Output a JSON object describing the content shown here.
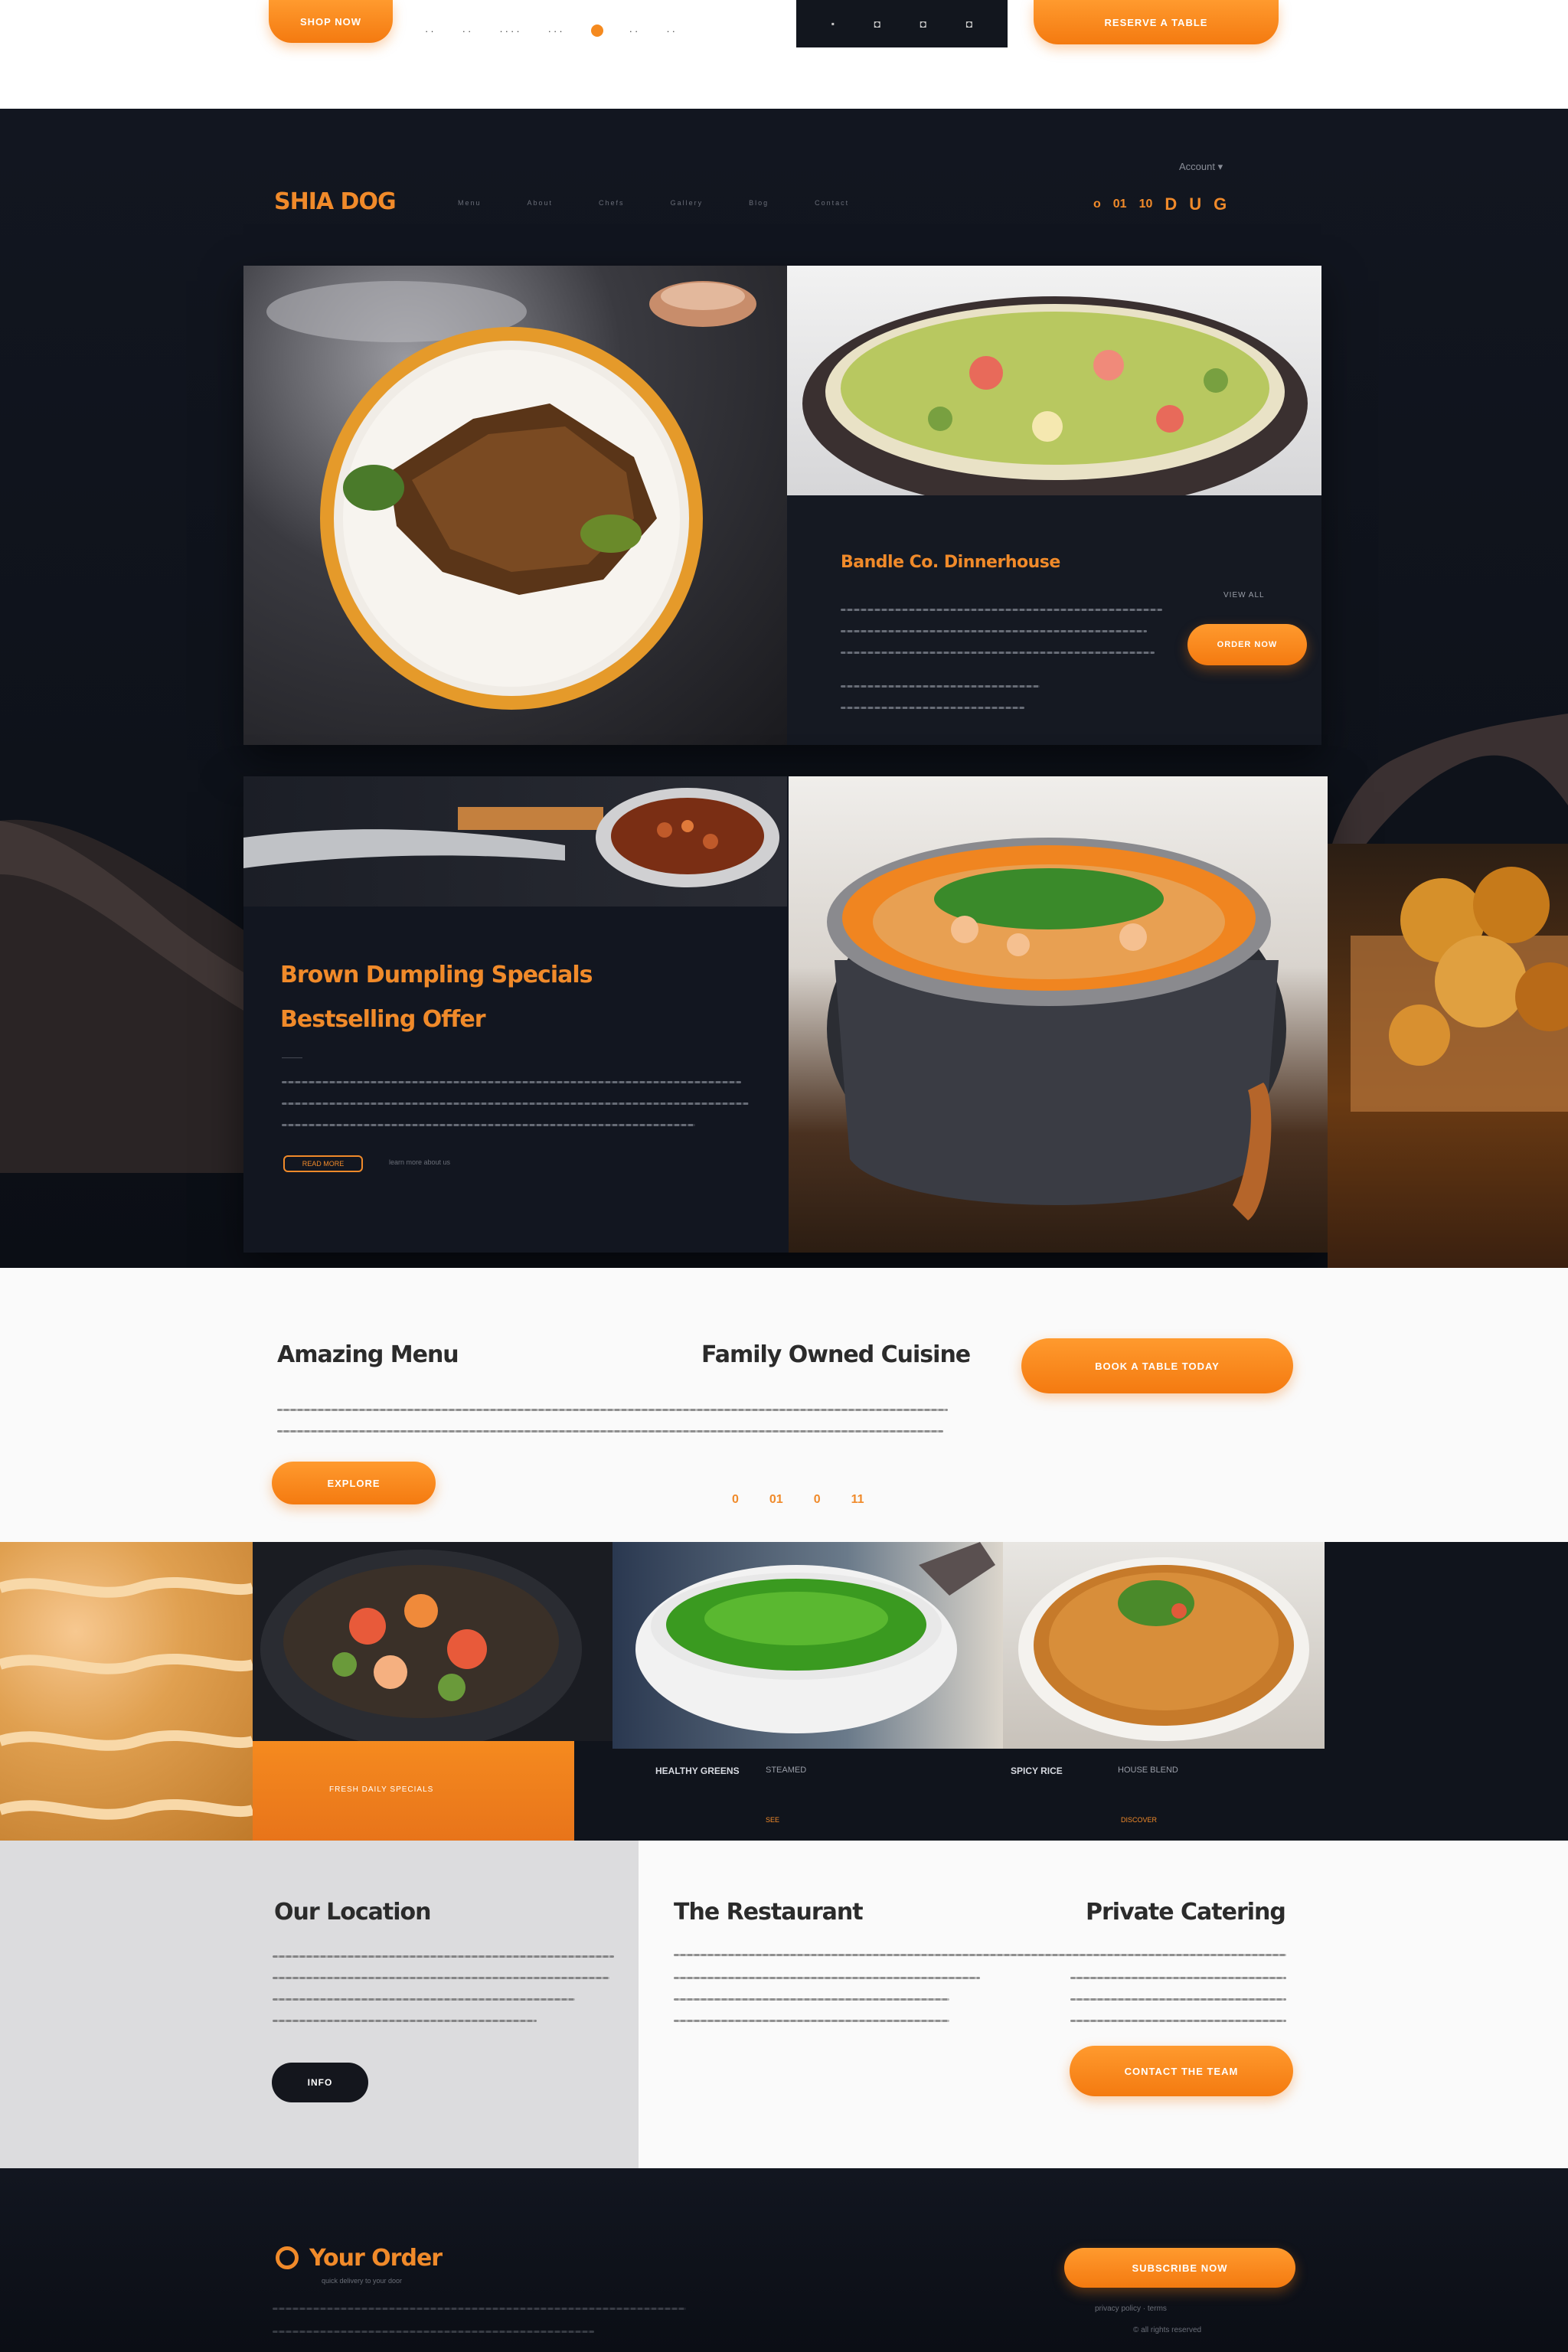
{
  "top": {
    "left_button": "SHOP NOW",
    "nav_dots": [
      "··",
      "··",
      "····",
      "···",
      "···",
      "··",
      "··"
    ],
    "dark_box_items": [
      "▪",
      "◘",
      "◘",
      "◘"
    ],
    "right_button": "RESERVE A TABLE"
  },
  "hero": {
    "logo": "SHIA DOG",
    "nav_items": [
      "Menu",
      "About",
      "Chefs",
      "Gallery",
      "Blog",
      "Contact"
    ],
    "account_label": "Account ▾",
    "right_nav": [
      "o",
      "01",
      "10",
      "D",
      "U",
      "G"
    ],
    "card1": {
      "title": "Bandle Co. Dinnerhouse",
      "tag": "VIEW ALL",
      "button": "ORDER NOW",
      "lines": [
        "",
        "",
        "",
        ""
      ]
    },
    "card2": {
      "title_line1": "Brown Dumpling Specials",
      "title_line2": "Bestselling Offer",
      "meta": "———",
      "link": "READ MORE",
      "link2": "learn more about us"
    }
  },
  "intro": {
    "title_left": "Amazing Menu",
    "title_center": "Family Owned Cuisine",
    "button_right": "BOOK A TABLE TODAY",
    "button_left": "EXPLORE",
    "pagination": [
      "0",
      "01",
      "0",
      "11"
    ]
  },
  "gallery": {
    "caption1": "FRESH DAILY SPECIALS",
    "caption2_title": "HEALTHY GREENS",
    "caption2_sub": "STEAMED",
    "caption2_link": "SEE",
    "caption3_title": "SPICY RICE",
    "caption3_sub": "HOUSE BLEND",
    "caption3_link": "DISCOVER"
  },
  "info": {
    "left_title": "Our Location",
    "left_button": "INFO",
    "mid_title": "The Restaurant",
    "right_title": "Private Catering",
    "right_button": "CONTACT THE TEAM"
  },
  "footer": {
    "title": "Your Order",
    "subtitle": "quick delivery to your door",
    "button": "SUBSCRIBE NOW",
    "small_text_1": "privacy policy · terms",
    "small_text_2": "© all rights reserved",
    "colors": {
      "accent": "#f58a1f",
      "dark": "#0f131b"
    }
  }
}
